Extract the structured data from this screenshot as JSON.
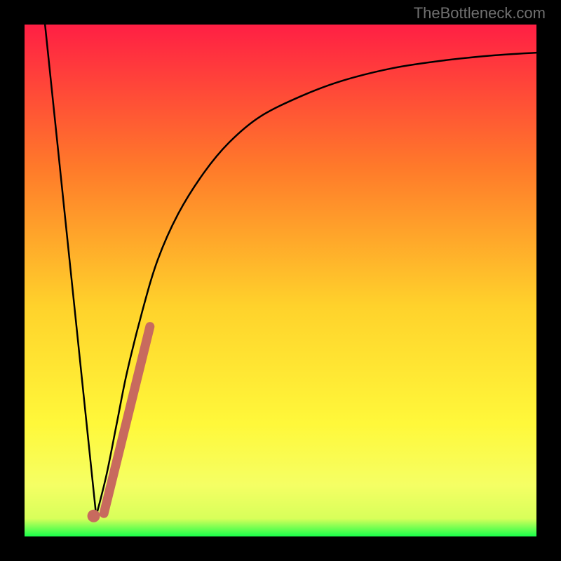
{
  "attribution": "TheBottleneck.com",
  "colors": {
    "bg_black": "#000000",
    "grad_top": "#ff1f44",
    "grad_mid1": "#ff7a2a",
    "grad_mid2": "#ffd22b",
    "grad_mid3": "#fff83a",
    "grad_band": "#f5ff64",
    "grad_green": "#18ff4a",
    "curve": "#000000",
    "marker": "#c86a5e"
  },
  "chart_data": {
    "type": "line",
    "title": "",
    "xlabel": "",
    "ylabel": "",
    "xlim": [
      0,
      100
    ],
    "ylim": [
      0,
      100
    ],
    "series": [
      {
        "name": "v-curve-left",
        "x": [
          4,
          14
        ],
        "y": [
          100,
          4
        ]
      },
      {
        "name": "v-curve-right",
        "x": [
          14,
          16,
          18,
          20,
          23,
          26,
          30,
          35,
          40,
          46,
          54,
          62,
          72,
          82,
          92,
          100
        ],
        "y": [
          4,
          12,
          22,
          32,
          44,
          54,
          63,
          71,
          77,
          82,
          86,
          89,
          91.5,
          93,
          94,
          94.5
        ]
      },
      {
        "name": "marker-segment",
        "x": [
          15.5,
          24.5
        ],
        "y": [
          4.5,
          41
        ]
      }
    ],
    "marker_dot": {
      "x": 13.5,
      "y": 4
    }
  }
}
